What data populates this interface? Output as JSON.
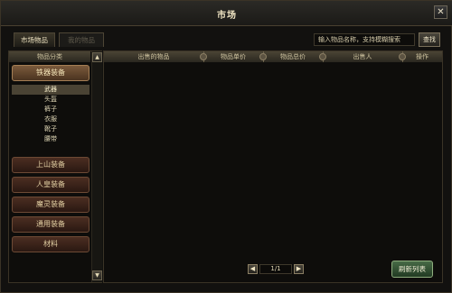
{
  "window": {
    "title": "市场",
    "close_label": "✕"
  },
  "tabs": [
    {
      "label": "市场物品",
      "active": true
    },
    {
      "label": "我的物品",
      "active": false
    }
  ],
  "search": {
    "placeholder": "输入物品名称，支持模糊搜索",
    "button_label": "查找"
  },
  "sidebar": {
    "header": "物品分类",
    "scroll_up": "▲",
    "scroll_down": "▼",
    "categories": [
      {
        "label": "铁器装备",
        "active": true
      },
      {
        "label": "上山装备",
        "active": false
      },
      {
        "label": "人皇装备",
        "active": false
      },
      {
        "label": "魔灵装备",
        "active": false
      },
      {
        "label": "通用装备",
        "active": false
      },
      {
        "label": "材料",
        "active": false
      }
    ],
    "subcategories": [
      {
        "label": "武器",
        "active": true
      },
      {
        "label": "头盔",
        "active": false
      },
      {
        "label": "裤子",
        "active": false
      },
      {
        "label": "衣服",
        "active": false
      },
      {
        "label": "靴子",
        "active": false
      },
      {
        "label": "腰带",
        "active": false
      }
    ]
  },
  "table": {
    "columns": [
      "出售的物品",
      "物品单价",
      "物品总价",
      "出售人",
      "操作"
    ],
    "rows": []
  },
  "pager": {
    "prev": "◀",
    "next": "▶",
    "text": "1/1"
  },
  "actions": {
    "refresh_label": "刷新列表"
  }
}
